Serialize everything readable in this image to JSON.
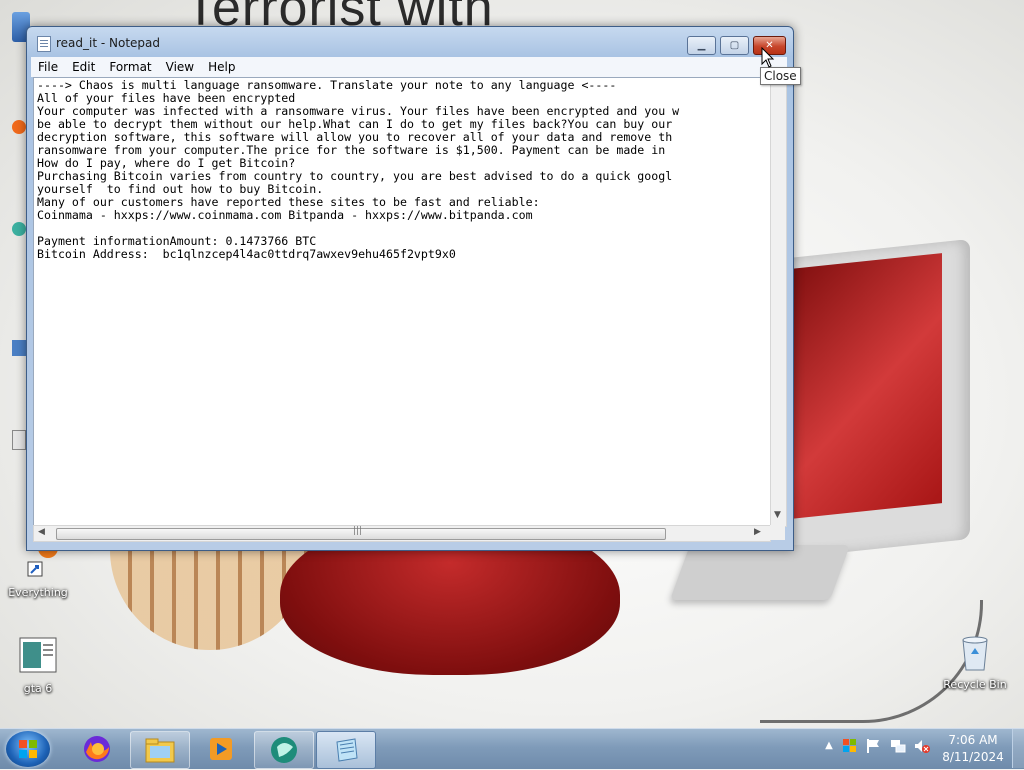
{
  "wallpaper": {
    "headline_text": "Terrorist with"
  },
  "desktop": {
    "icons": [
      {
        "label": "Everything"
      },
      {
        "label": "gta 6"
      },
      {
        "label": "Recycle Bin"
      }
    ]
  },
  "notepad": {
    "title": "read_it - Notepad",
    "menu": [
      "File",
      "Edit",
      "Format",
      "View",
      "Help"
    ],
    "content": "----> Chaos is multi language ransomware. Translate your note to any language <----\nAll of your files have been encrypted\nYour computer was infected with a ransomware virus. Your files have been encrypted and you w\nbe able to decrypt them without our help.What can I do to get my files back?You can buy our\ndecryption software, this software will allow you to recover all of your data and remove th\nransomware from your computer.The price for the software is $1,500. Payment can be made in\nHow do I pay, where do I get Bitcoin?\nPurchasing Bitcoin varies from country to country, you are best advised to do a quick googl\nyourself  to find out how to buy Bitcoin.\nMany of our customers have reported these sites to be fast and reliable:\nCoinmama - hxxps://www.coinmama.com Bitpanda - hxxps://www.bitpanda.com\n\nPayment informationAmount: 0.1473766 BTC\nBitcoin Address:  bc1qlnzcep4l4ac0ttdrq7awxev9ehu465f2vpt9x0",
    "tooltip": "Close"
  },
  "taskbar": {
    "time": "7:06 AM",
    "date": "8/11/2024",
    "pinned_icons": [
      "windows-start-icon",
      "firefox-icon",
      "file-explorer-icon",
      "media-player-icon",
      "app-icon",
      "notepad-icon"
    ],
    "tray_icons": [
      "show-hidden-icons-icon",
      "action-center-flag-icon",
      "network-icon",
      "volume-muted-icon"
    ]
  },
  "colors": {
    "title_bar": "#b8cce6",
    "close_button": "#c7462c",
    "taskbar": "#7f9bb9"
  }
}
